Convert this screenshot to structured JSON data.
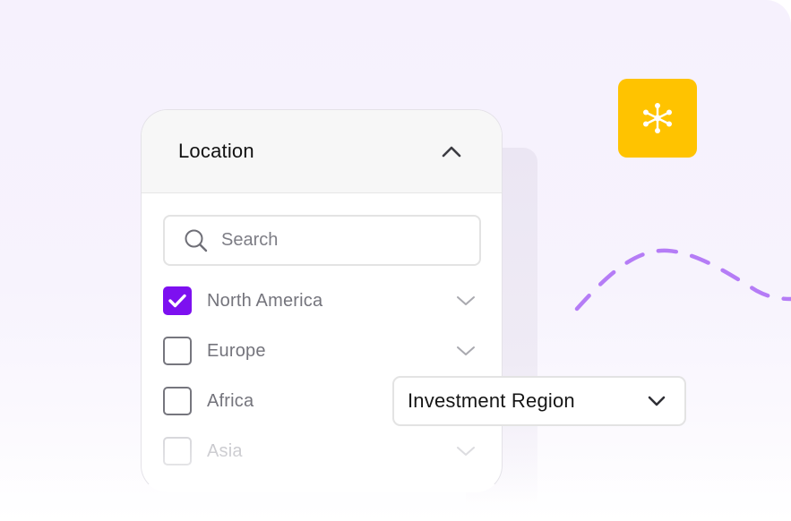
{
  "colors": {
    "accent": "#7d10f0",
    "badge": "#ffc300",
    "wave": "#b57cf6",
    "background": "#f6f1fd"
  },
  "location_panel": {
    "title": "Location",
    "collapse_icon": "chevron-up-icon",
    "search": {
      "placeholder": "Search",
      "value": "",
      "icon": "search-icon"
    },
    "options": [
      {
        "label": "North America",
        "checked": true,
        "expand_icon": "chevron-down-icon"
      },
      {
        "label": "Europe",
        "checked": false,
        "expand_icon": "chevron-down-icon"
      },
      {
        "label": "Africa",
        "checked": false,
        "expand_icon": "chevron-down-icon"
      },
      {
        "label": "Asia",
        "checked": false,
        "expand_icon": "chevron-down-icon"
      }
    ]
  },
  "badge": {
    "icon": "network-hub-icon"
  },
  "investment_select": {
    "label": "Investment Region",
    "icon": "chevron-down-icon"
  }
}
